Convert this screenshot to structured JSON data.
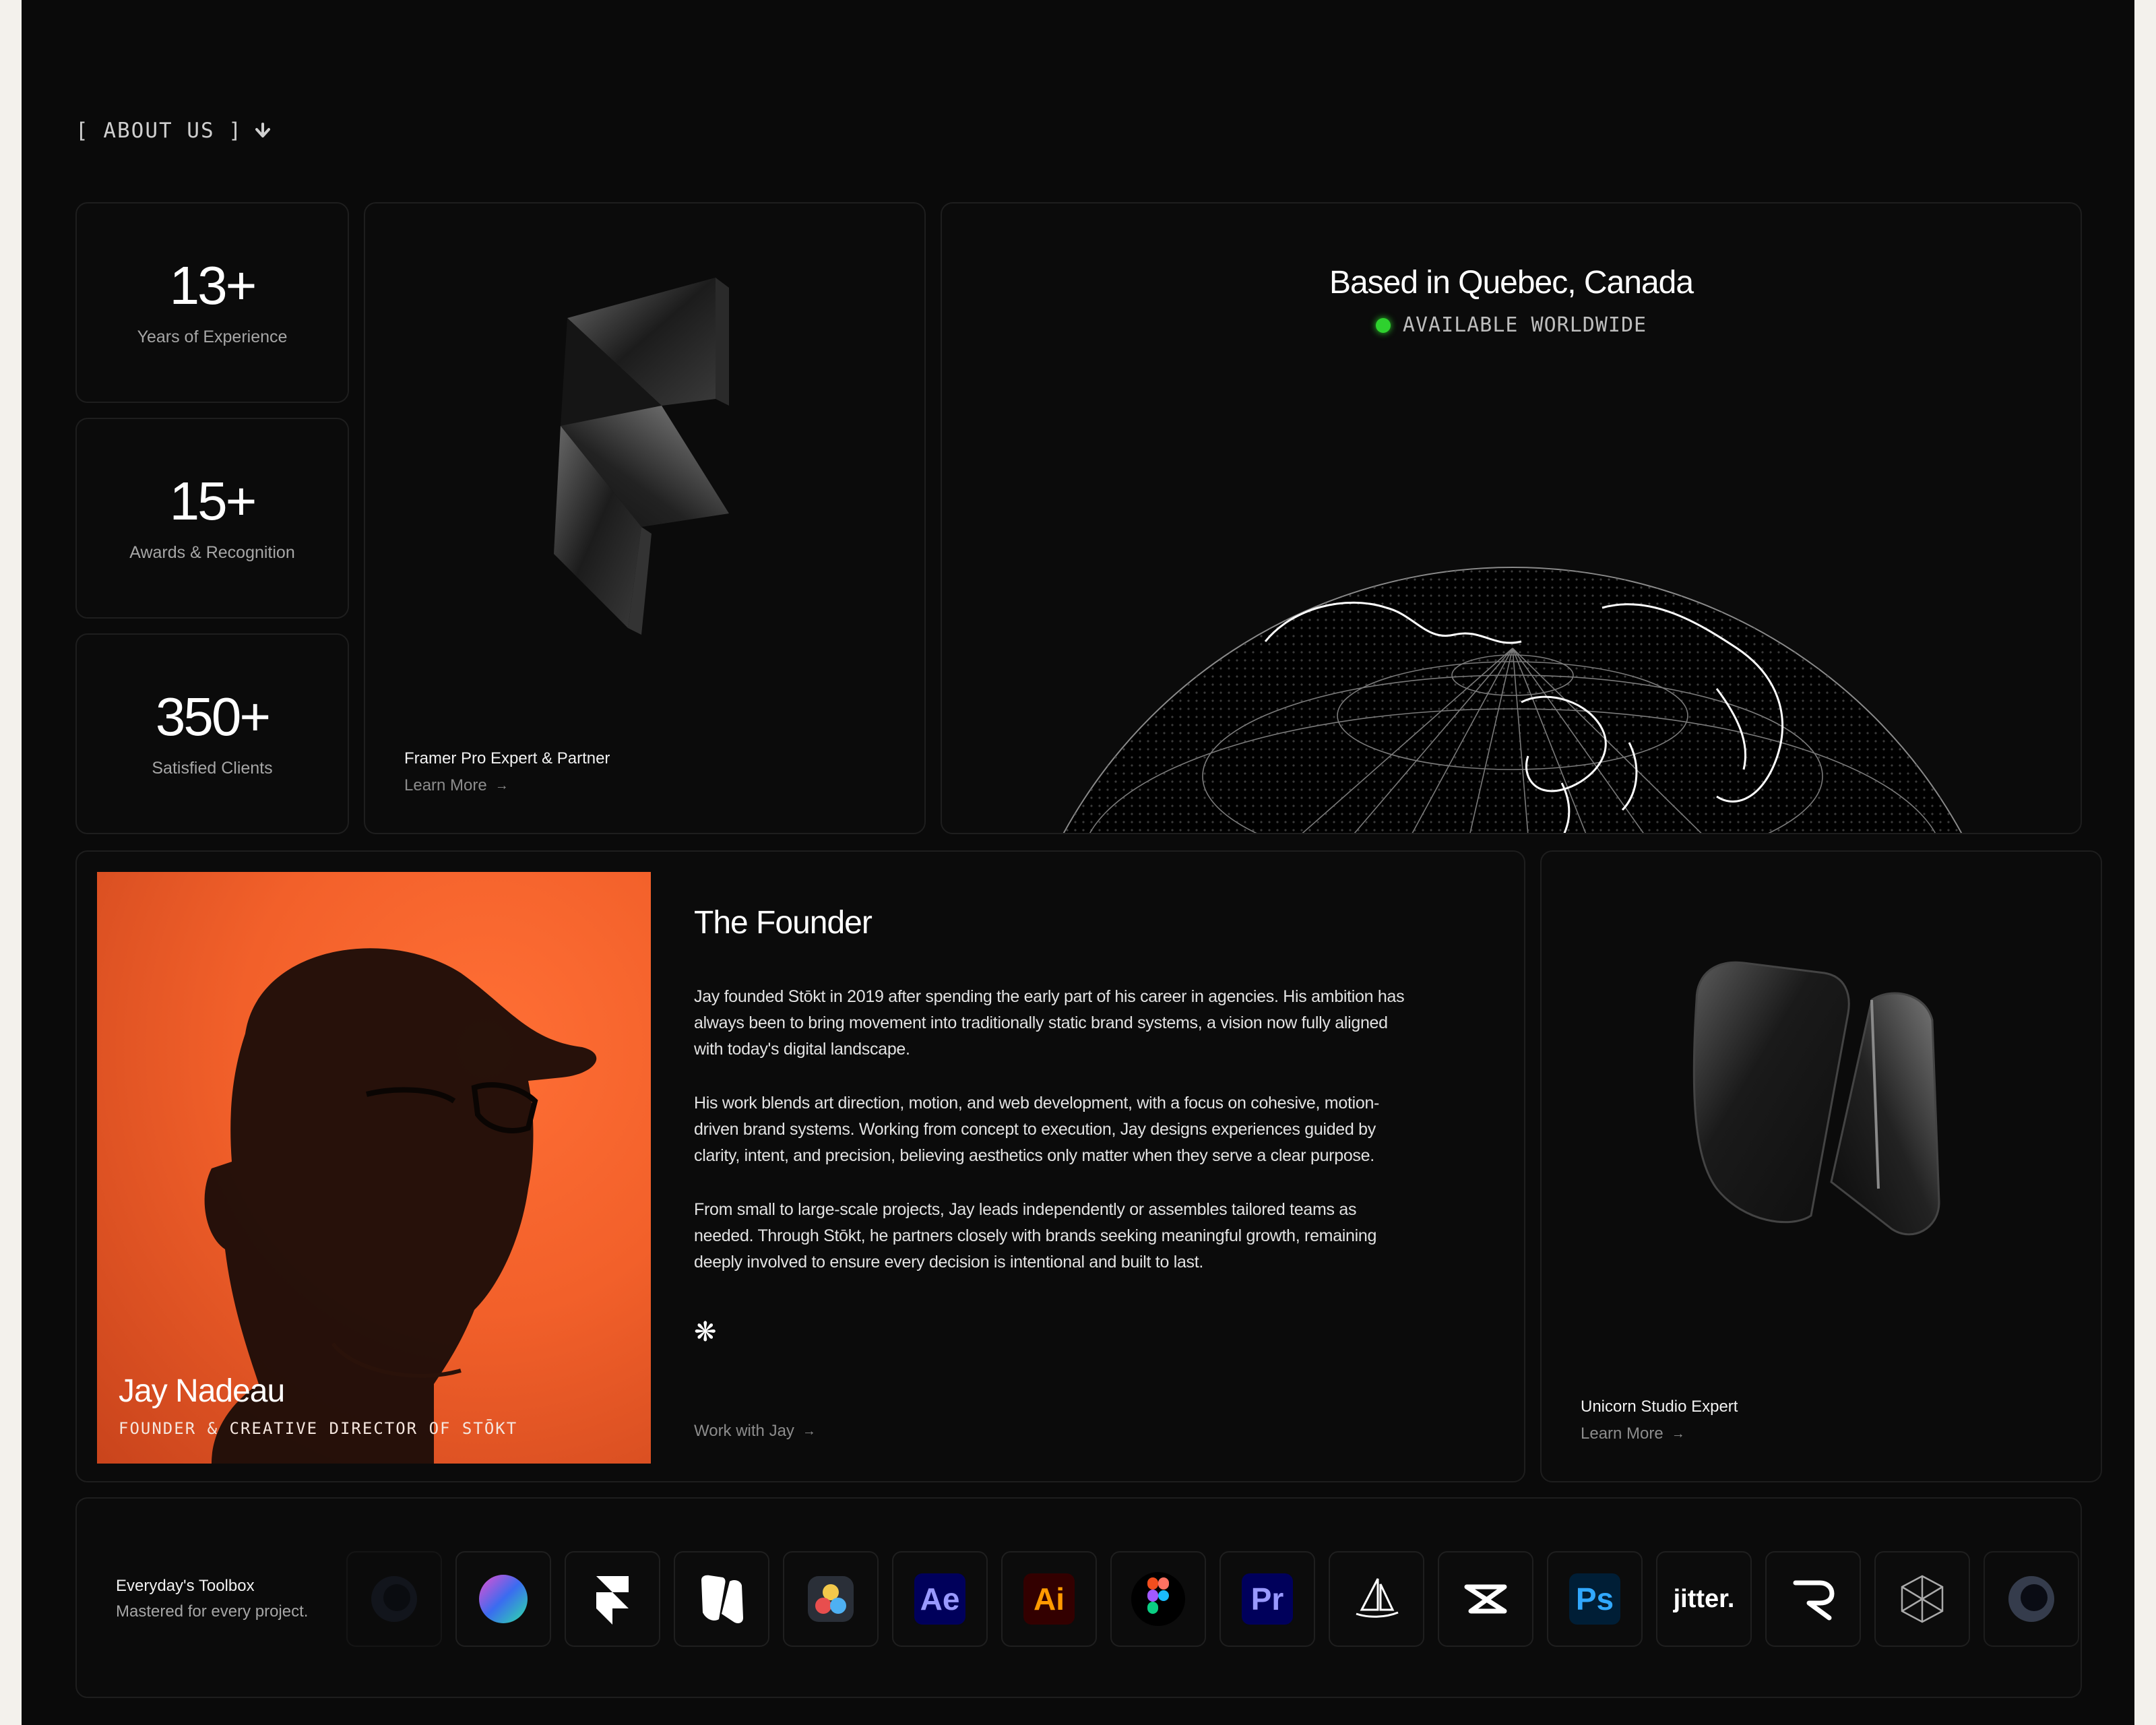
{
  "section": {
    "label": "[ ABOUT US ]"
  },
  "stats": [
    {
      "value": "13+",
      "label": "Years of Experience"
    },
    {
      "value": "15+",
      "label": "Awards & Recognition"
    },
    {
      "value": "350+",
      "label": "Satisfied Clients"
    }
  ],
  "framer_card": {
    "title": "Framer Pro Expert & Partner",
    "link": "Learn More"
  },
  "location": {
    "title": "Based in Quebec, Canada",
    "status": "AVAILABLE WORLDWIDE"
  },
  "founder": {
    "name": "Jay Nadeau",
    "role": "FOUNDER & CREATIVE DIRECTOR OF STŌKT",
    "heading": "The Founder",
    "paragraphs": [
      "Jay founded Stōkt in 2019 after spending the early part of his career in agencies. His ambition has always been to bring movement into traditionally static brand systems, a vision now fully aligned with today's digital landscape.",
      "His work blends art direction, motion, and web development, with a focus on cohesive, motion-driven brand systems. Working from concept to execution, Jay designs experiences guided by clarity, intent, and precision, believing aesthetics only matter when they serve a clear purpose.",
      "From small to large-scale projects, Jay leads independently or assembles tailored teams as needed. Through Stōkt, he partners closely with brands seeking meaningful growth, remaining deeply involved to ensure every decision is intentional and built to last."
    ],
    "cta": "Work with Jay"
  },
  "unicorn_card": {
    "title": "Unicorn Studio Expert",
    "link": "Learn More"
  },
  "toolbox": {
    "title": "Everyday's Toolbox",
    "subtitle": "Mastered for every project.",
    "tools": [
      {
        "name": "Cinema 4D",
        "icon": "cinema4d-icon",
        "short": ""
      },
      {
        "name": "Gradient",
        "icon": "gradient-orb-icon",
        "short": ""
      },
      {
        "name": "Framer",
        "icon": "framer-icon",
        "short": ""
      },
      {
        "name": "Unicorn Studio",
        "icon": "unicorn-studio-icon",
        "short": ""
      },
      {
        "name": "DaVinci Resolve",
        "icon": "davinci-resolve-icon",
        "short": ""
      },
      {
        "name": "After Effects",
        "icon": "after-effects-icon",
        "short": "Ae"
      },
      {
        "name": "Illustrator",
        "icon": "illustrator-icon",
        "short": "Ai"
      },
      {
        "name": "Figma",
        "icon": "figma-icon",
        "short": ""
      },
      {
        "name": "Premiere Pro",
        "icon": "premiere-pro-icon",
        "short": "Pr"
      },
      {
        "name": "Midjourney",
        "icon": "midjourney-icon",
        "short": ""
      },
      {
        "name": "CapCut",
        "icon": "capcut-icon",
        "short": ""
      },
      {
        "name": "Photoshop",
        "icon": "photoshop-icon",
        "short": "Ps"
      },
      {
        "name": "Jitter",
        "icon": "jitter-icon",
        "short": "jitter."
      },
      {
        "name": "Rive",
        "icon": "rive-icon",
        "short": ""
      },
      {
        "name": "Spline",
        "icon": "spline-icon",
        "short": ""
      },
      {
        "name": "Cinema 4D",
        "icon": "cinema4d-icon",
        "short": ""
      }
    ]
  },
  "colors": {
    "background": "#0a0a0a",
    "accent_orange": "#f2602a",
    "status_green": "#2ed12e"
  }
}
